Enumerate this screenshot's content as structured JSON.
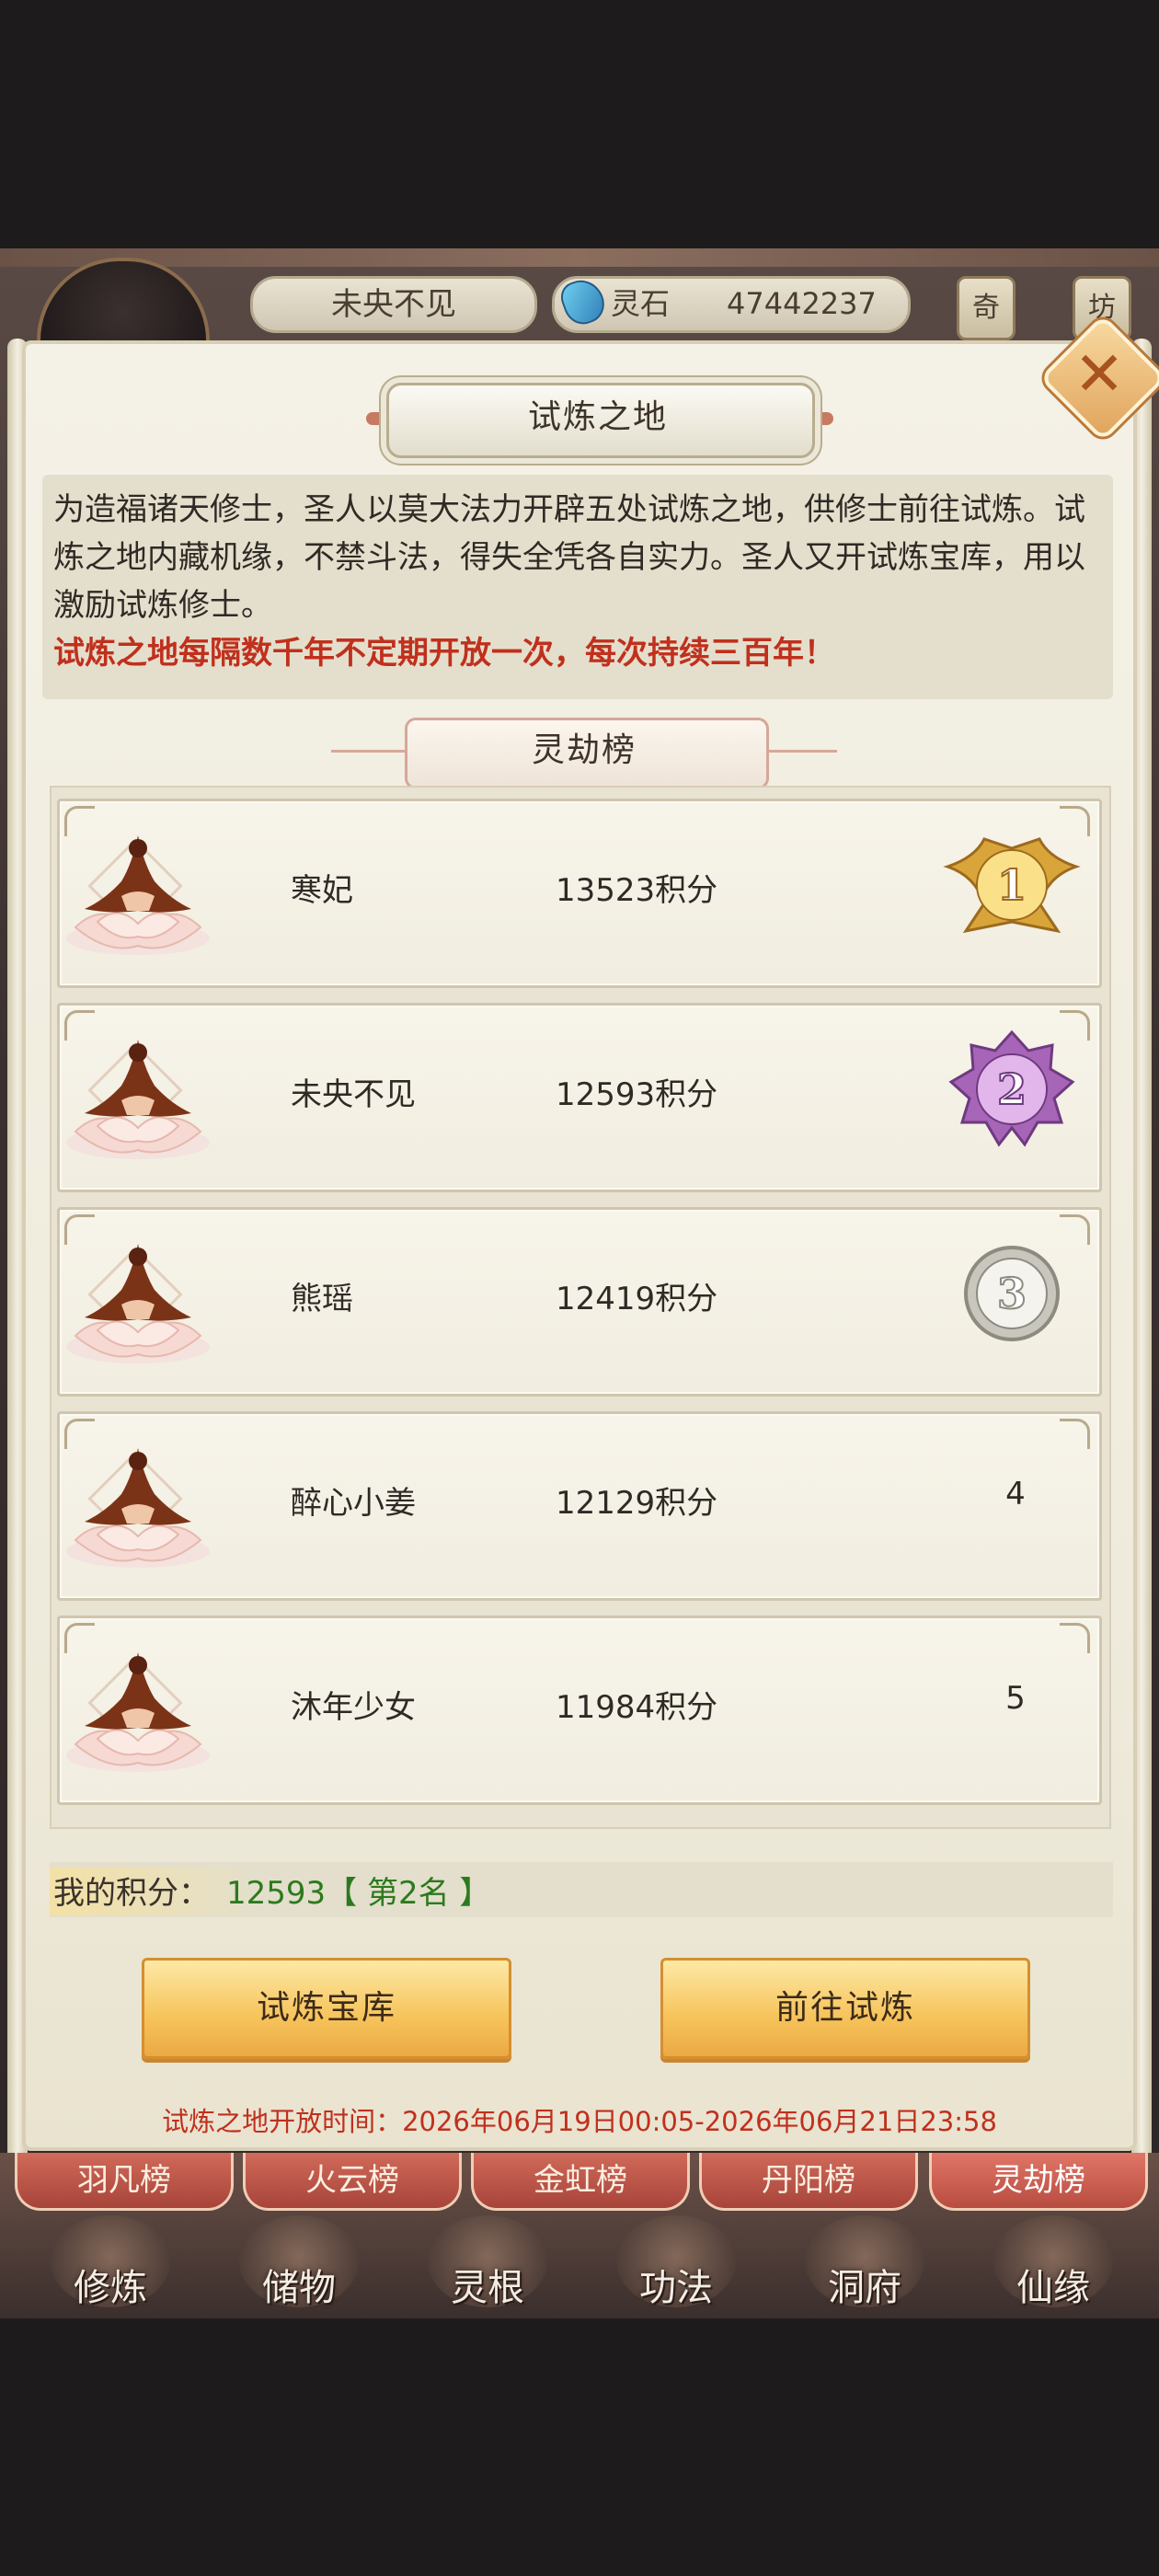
{
  "topbar": {
    "player_name": "未央不见",
    "currency_label": "灵石",
    "currency_value": "47442237",
    "side_tab_1": "奇",
    "side_tab_2": "坊"
  },
  "panel": {
    "title": "试炼之地",
    "description": "为造福诸天修士，圣人以莫大法力开辟五处试炼之地，供修士前往试炼。试炼之地内藏机缘，不禁斗法，得失全凭各自实力。圣人又开试炼宝库，用以激励试炼修士。",
    "notice": "试炼之地每隔数千年不定期开放一次，每次持续三百年！",
    "board_title": "灵劫榜"
  },
  "ranking": [
    {
      "rank": "1",
      "name": "寒妃",
      "score": "13523积分",
      "medal": "gold"
    },
    {
      "rank": "2",
      "name": "未央不见",
      "score": "12593积分",
      "medal": "purple"
    },
    {
      "rank": "3",
      "name": "熊瑶",
      "score": "12419积分",
      "medal": "silver"
    },
    {
      "rank": "4",
      "name": "醉心小姜",
      "score": "12129积分",
      "medal": "none"
    },
    {
      "rank": "5",
      "name": "沐年少女",
      "score": "11984积分",
      "medal": "none"
    }
  ],
  "my_score": {
    "label": "我的积分：",
    "value": "12593【 第2名 】"
  },
  "buttons": {
    "treasury": "试炼宝库",
    "go_trial": "前往试炼"
  },
  "open_time": "试炼之地开放时间：2026年06月19日00:05-2026年06月21日23:58",
  "tabs": [
    "羽凡榜",
    "火云榜",
    "金虹榜",
    "丹阳榜",
    "灵劫榜"
  ],
  "active_tab": "灵劫榜",
  "bottom_nav": [
    "修炼",
    "储物",
    "灵根",
    "功法",
    "洞府",
    "仙缘"
  ],
  "colors": {
    "notice_red": "#c0301d",
    "my_score_green": "#2d7a1e",
    "button_gold": "#f6c35a",
    "tab_red": "#a7443a"
  }
}
